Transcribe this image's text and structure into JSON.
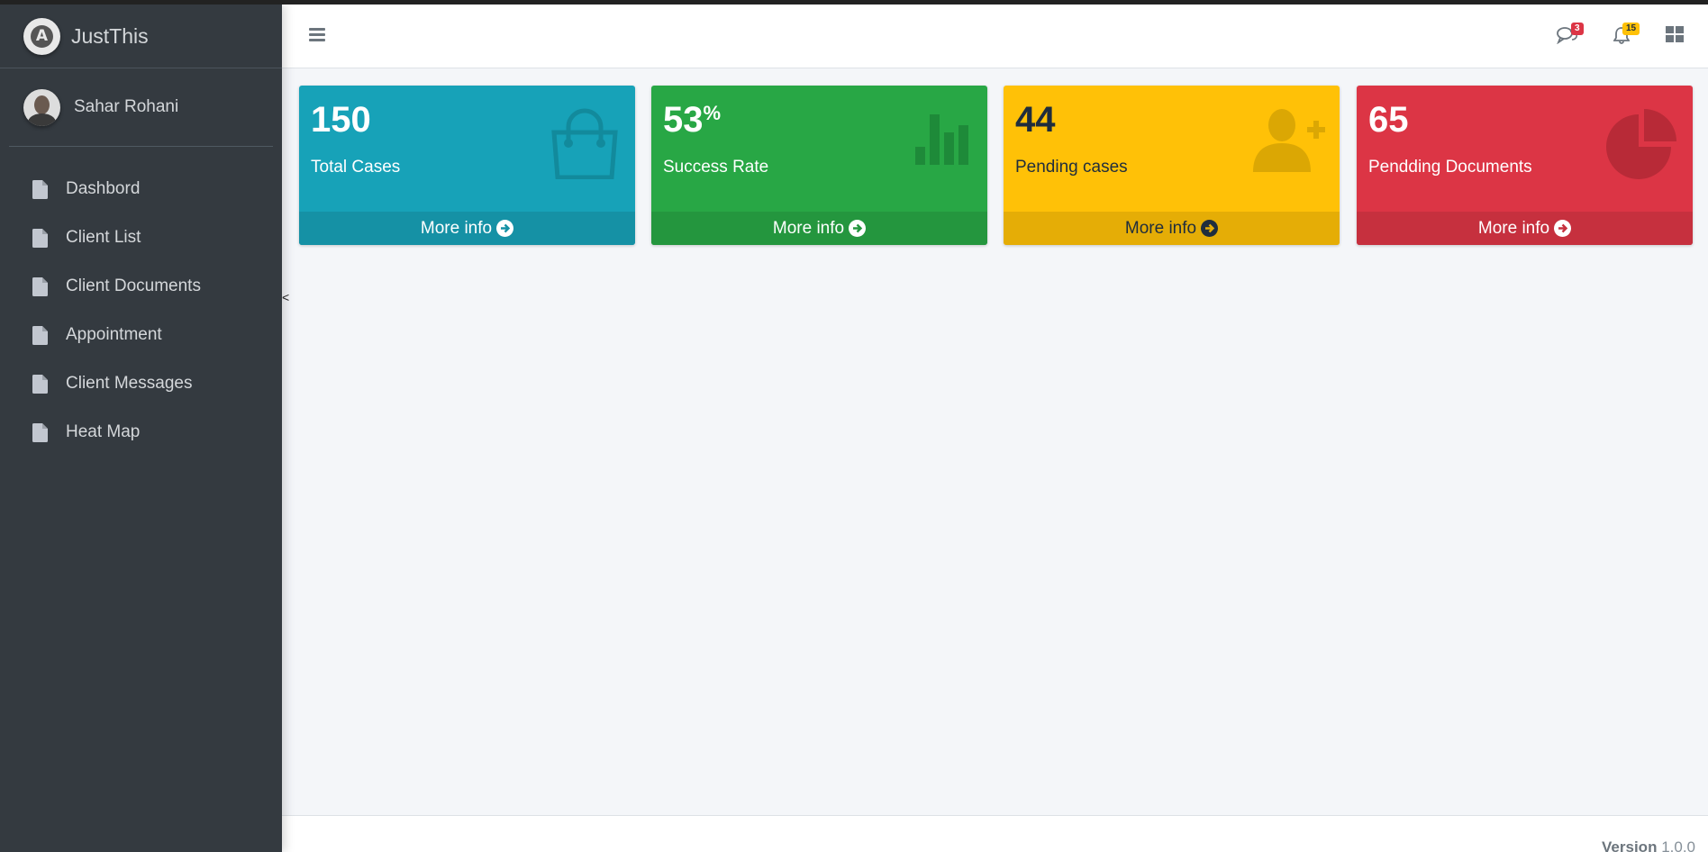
{
  "brand": {
    "name": "JustThis"
  },
  "user": {
    "name": "Sahar Rohani"
  },
  "sidebar": {
    "items": [
      {
        "label": "Dashbord",
        "icon": "file-icon"
      },
      {
        "label": "Client List",
        "icon": "file-icon"
      },
      {
        "label": "Client Documents",
        "icon": "file-icon"
      },
      {
        "label": "Appointment",
        "icon": "file-icon"
      },
      {
        "label": "Client Messages",
        "icon": "file-icon"
      },
      {
        "label": "Heat Map",
        "icon": "file-icon"
      }
    ]
  },
  "header": {
    "messages_badge": "3",
    "notifications_badge": "15"
  },
  "collapse_symbol": "<",
  "boxes": [
    {
      "value": "150",
      "label": "Total Cases",
      "link": "More info",
      "icon": "shopping-bag-icon",
      "color": "#17a2b8"
    },
    {
      "value": "53",
      "suffix": "%",
      "label": "Success Rate",
      "link": "More info",
      "icon": "bar-chart-icon",
      "color": "#28a745"
    },
    {
      "value": "44",
      "label": "Pending cases",
      "link": "More info",
      "icon": "user-plus-icon",
      "color": "#ffc107"
    },
    {
      "value": "65",
      "label": "Pendding Documents",
      "link": "More info",
      "icon": "pie-chart-icon",
      "color": "#dc3545"
    }
  ],
  "footer": {
    "version_label": "Version",
    "version_number": "1.0.0"
  }
}
